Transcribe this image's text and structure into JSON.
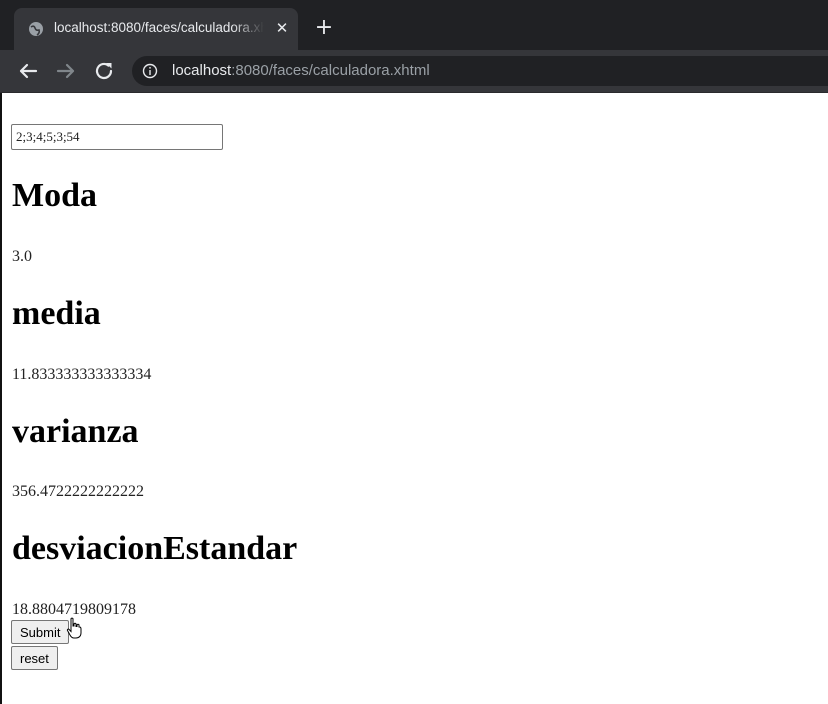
{
  "browser": {
    "tab_title": "localhost:8080/faces/calculadora.xhtml",
    "url_host": "localhost",
    "url_rest": ":8080/faces/calculadora.xhtml",
    "icons": [
      "globe-icon",
      "close-icon",
      "plus-icon",
      "back-arrow-icon",
      "forward-arrow-icon",
      "reload-icon",
      "info-icon"
    ]
  },
  "form": {
    "input_value": "2;3;4;5;3;54",
    "sections": [
      {
        "heading": "Moda",
        "value": "3.0"
      },
      {
        "heading": "media",
        "value": "11.833333333333334"
      },
      {
        "heading": "varianza",
        "value": "356.4722222222222"
      },
      {
        "heading": "desviacionEstandar",
        "value": "18.8804719809178"
      }
    ],
    "submit_label": "Submit",
    "reset_label": "reset"
  }
}
